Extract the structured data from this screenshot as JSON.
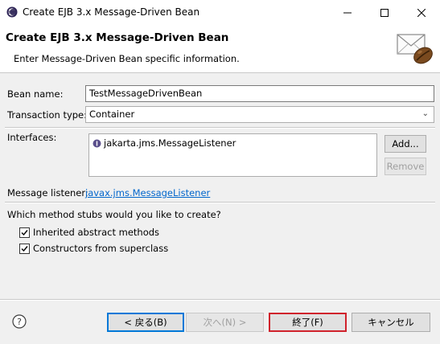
{
  "window": {
    "title": "Create EJB 3.x Message-Driven Bean"
  },
  "banner": {
    "title": "Create EJB 3.x Message-Driven Bean",
    "description": "Enter Message-Driven Bean specific information."
  },
  "form": {
    "bean_name_label": "Bean name:",
    "bean_name_value": "TestMessageDrivenBean",
    "transaction_type_label": "Transaction type:",
    "transaction_type_value": "Container",
    "interfaces_label": "Interfaces:",
    "interfaces": [
      {
        "name": "jakarta.jms.MessageListener",
        "icon": "interface-icon"
      }
    ],
    "add_button": "Add...",
    "remove_button": "Remove",
    "message_listener_label": "Message listener:",
    "message_listener_link": "javax.jms.MessageListener"
  },
  "stubs": {
    "question": "Which method stubs would you like to create?",
    "options": [
      {
        "label": "Inherited abstract methods",
        "checked": true
      },
      {
        "label": "Constructors from superclass",
        "checked": true
      }
    ]
  },
  "footer": {
    "back_button": "< 戻る(B)",
    "next_button": "次へ(N) >",
    "finish_button": "終了(F)",
    "cancel_button": "キャンセル"
  },
  "colors": {
    "link": "#0066cc",
    "focus_border": "#0078d7",
    "finish_highlight": "#d0222c"
  }
}
